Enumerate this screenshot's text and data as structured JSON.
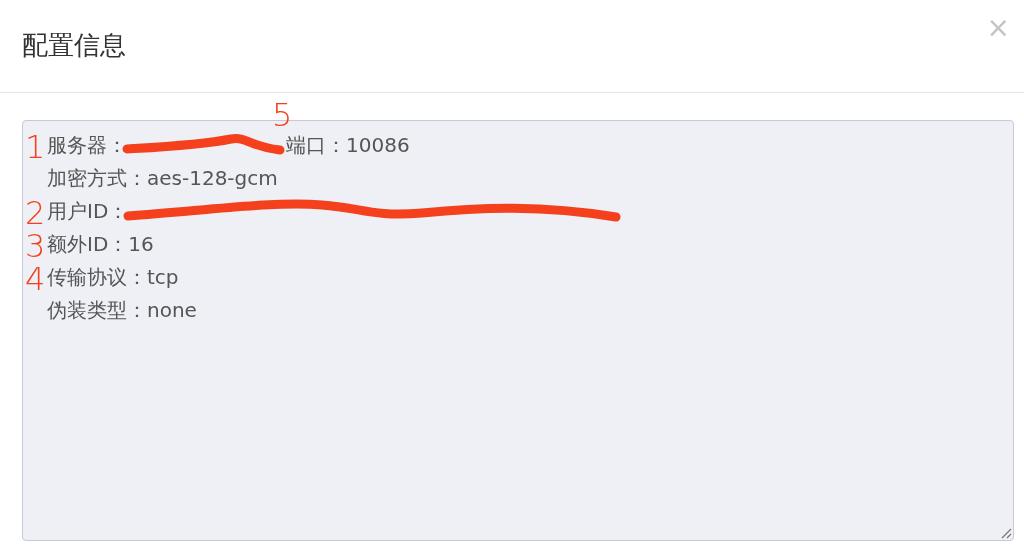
{
  "dialog": {
    "title": "配置信息",
    "close": "×"
  },
  "config_box": {
    "lines": [
      {
        "marker": "1",
        "segments": [
          {
            "kind": "text",
            "text": "服务器："
          },
          {
            "kind": "scribble-short"
          },
          {
            "kind": "text",
            "text": "端口：10086",
            "marker": "5"
          }
        ]
      },
      {
        "segments": [
          {
            "kind": "text",
            "text": "加密方式：aes-128-gcm"
          }
        ]
      },
      {
        "marker": "2",
        "segments": [
          {
            "kind": "text",
            "text": "用户ID："
          },
          {
            "kind": "scribble-long"
          }
        ]
      },
      {
        "marker": "3",
        "segments": [
          {
            "kind": "text",
            "text": "额外ID：16"
          }
        ]
      },
      {
        "marker": "4",
        "segments": [
          {
            "kind": "text",
            "text": "传输协议：tcp"
          }
        ]
      },
      {
        "segments": [
          {
            "kind": "text",
            "text": "伪装类型：none"
          }
        ]
      }
    ]
  }
}
